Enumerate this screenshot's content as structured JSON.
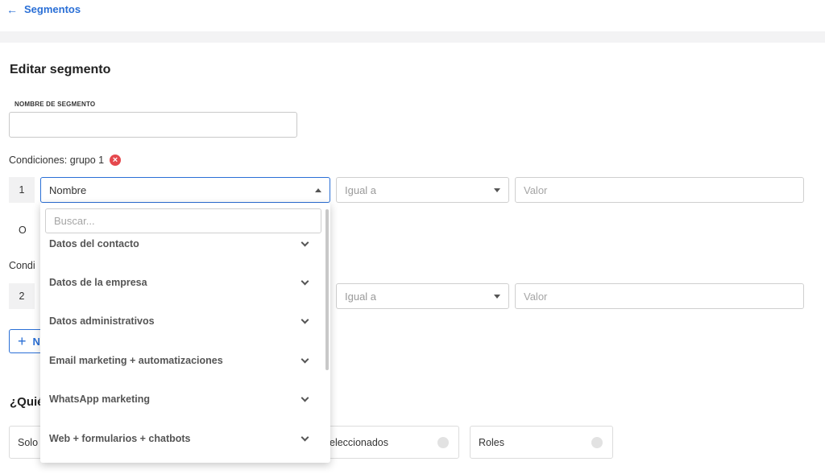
{
  "header": {
    "back_label": "Segmentos",
    "back_icon": "arrow-left-icon"
  },
  "page_title": "Editar segmento",
  "name_field": {
    "label": "NOMBRE DE SEGMENTO",
    "value": "",
    "placeholder": ""
  },
  "groups": [
    {
      "title": "Condiciones: grupo 1",
      "row_number": "1",
      "field_select": "Nombre",
      "operator_placeholder": "Igual a",
      "value_placeholder": "Valor"
    },
    {
      "title": "Condi",
      "row_number": "2",
      "operator_placeholder": "Igual a",
      "value_placeholder": "Valor"
    }
  ],
  "or_label": "O",
  "add_button": {
    "label": "N"
  },
  "who_section": {
    "title": "¿Quién"
  },
  "options": [
    {
      "label": "Solo"
    },
    {
      "label": "eleccionados"
    },
    {
      "label": "Roles"
    }
  ],
  "dropdown": {
    "search_placeholder": "Buscar...",
    "items": [
      "Datos del contacto",
      "Datos de la empresa",
      "Datos administrativos",
      "Email marketing + automatizaciones",
      "WhatsApp marketing",
      "Web + formularios + chatbots"
    ]
  },
  "colors": {
    "accent": "#2a6fd6",
    "danger": "#e5484d"
  }
}
